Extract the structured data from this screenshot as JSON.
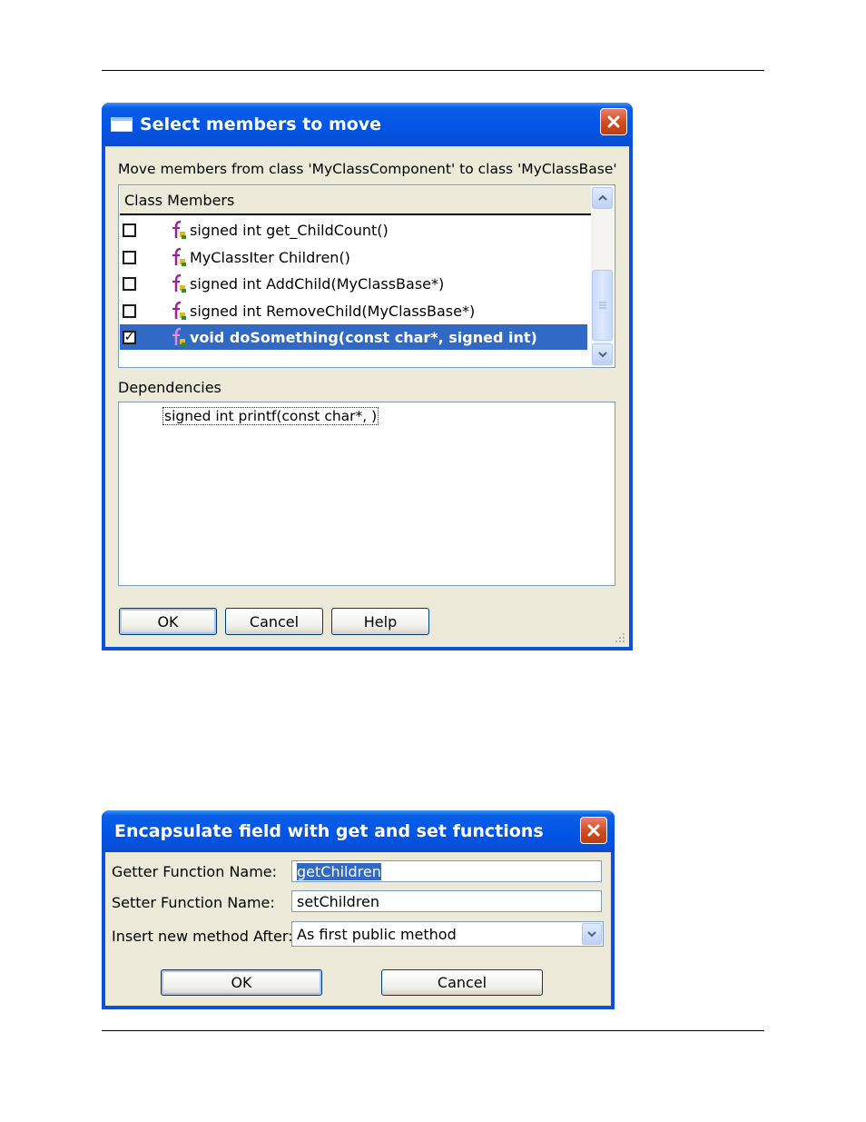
{
  "dialog1": {
    "title": "Select members to move",
    "move_text": "Move members from class 'MyClassComponent' to class 'MyClassBase'",
    "list_header": "Class Members",
    "members": [
      {
        "label": "signed int get_ChildCount()",
        "checked": false,
        "selected": false
      },
      {
        "label": "MyClassIter Children()",
        "checked": false,
        "selected": false
      },
      {
        "label": "signed int AddChild(MyClassBase*)",
        "checked": false,
        "selected": false
      },
      {
        "label": "signed int RemoveChild(MyClassBase*)",
        "checked": false,
        "selected": false
      },
      {
        "label": "void doSomething(const char*, signed int)",
        "checked": true,
        "selected": true
      }
    ],
    "dependencies_label": "Dependencies",
    "dependency_item": "signed int printf(const char*, )",
    "ok_label": "OK",
    "cancel_label": "Cancel",
    "help_label": "Help"
  },
  "dialog2": {
    "title": "Encapsulate field with get and set functions",
    "getter_label": "Getter Function Name:",
    "getter_value": "getChildren",
    "setter_label": "Setter Function Name:",
    "setter_value": "setChildren",
    "insert_label": "Insert new method After:",
    "insert_value": "As first public method",
    "ok_label": "OK",
    "cancel_label": "Cancel"
  },
  "colors": {
    "titlebar": "#0155e6",
    "selection": "#316ac5",
    "dialog_bg": "#ece9d8",
    "close": "#d24a1e"
  }
}
